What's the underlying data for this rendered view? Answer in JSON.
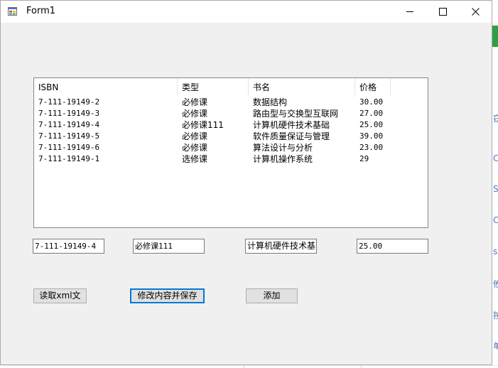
{
  "window": {
    "title": "Form1"
  },
  "listview": {
    "columns": [
      "ISBN",
      "类型",
      "书名",
      "价格"
    ],
    "rows": [
      [
        "7-111-19149-2",
        "必修课",
        "数据结构",
        "30.00"
      ],
      [
        "7-111-19149-3",
        "必修课",
        "路由型与交换型互联网",
        "27.00"
      ],
      [
        "7-111-19149-4",
        "必修课111",
        "计算机硬件技术基础",
        "25.00"
      ],
      [
        "7-111-19149-5",
        "必修课",
        "软件质量保证与管理",
        "39.00"
      ],
      [
        "7-111-19149-6",
        "必修课",
        "算法设计与分析",
        "23.00"
      ],
      [
        "7-111-19149-1",
        "选修课",
        "计算机操作系统",
        "29"
      ]
    ]
  },
  "fields": {
    "isbn": "7-111-19149-4",
    "type": "必修课111",
    "name": "计算机硬件技术基",
    "price": "25.00"
  },
  "buttons": {
    "read_xml": "读取xml文",
    "modify_save": "修改内容并保存",
    "add": "添加"
  },
  "background_glyphs": [
    "窃",
    "C",
    "S",
    "C",
    "s",
    "攸",
    "按",
    "单"
  ],
  "colors": {
    "accent_focus": "#0078d7",
    "form_bg": "#f0f0f0",
    "button_bg": "#e1e1e1"
  }
}
